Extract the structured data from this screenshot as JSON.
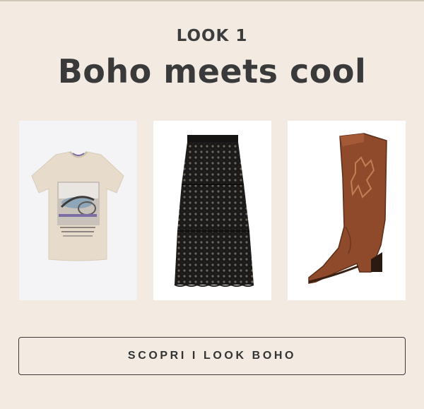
{
  "look": {
    "eyebrow": "LOOK 1",
    "title": "Boho meets cool"
  },
  "products": [
    {
      "name": "tshirt-image",
      "icon": "printed-tshirt-icon",
      "color": "#e7dccb"
    },
    {
      "name": "skirt-image",
      "icon": "lace-skirt-icon",
      "color": "#1c1a19"
    },
    {
      "name": "boot-image",
      "icon": "cowboy-boot-icon",
      "color": "#8f4a2b"
    }
  ],
  "cta": {
    "label": "SCOPRI I LOOK BOHO"
  }
}
